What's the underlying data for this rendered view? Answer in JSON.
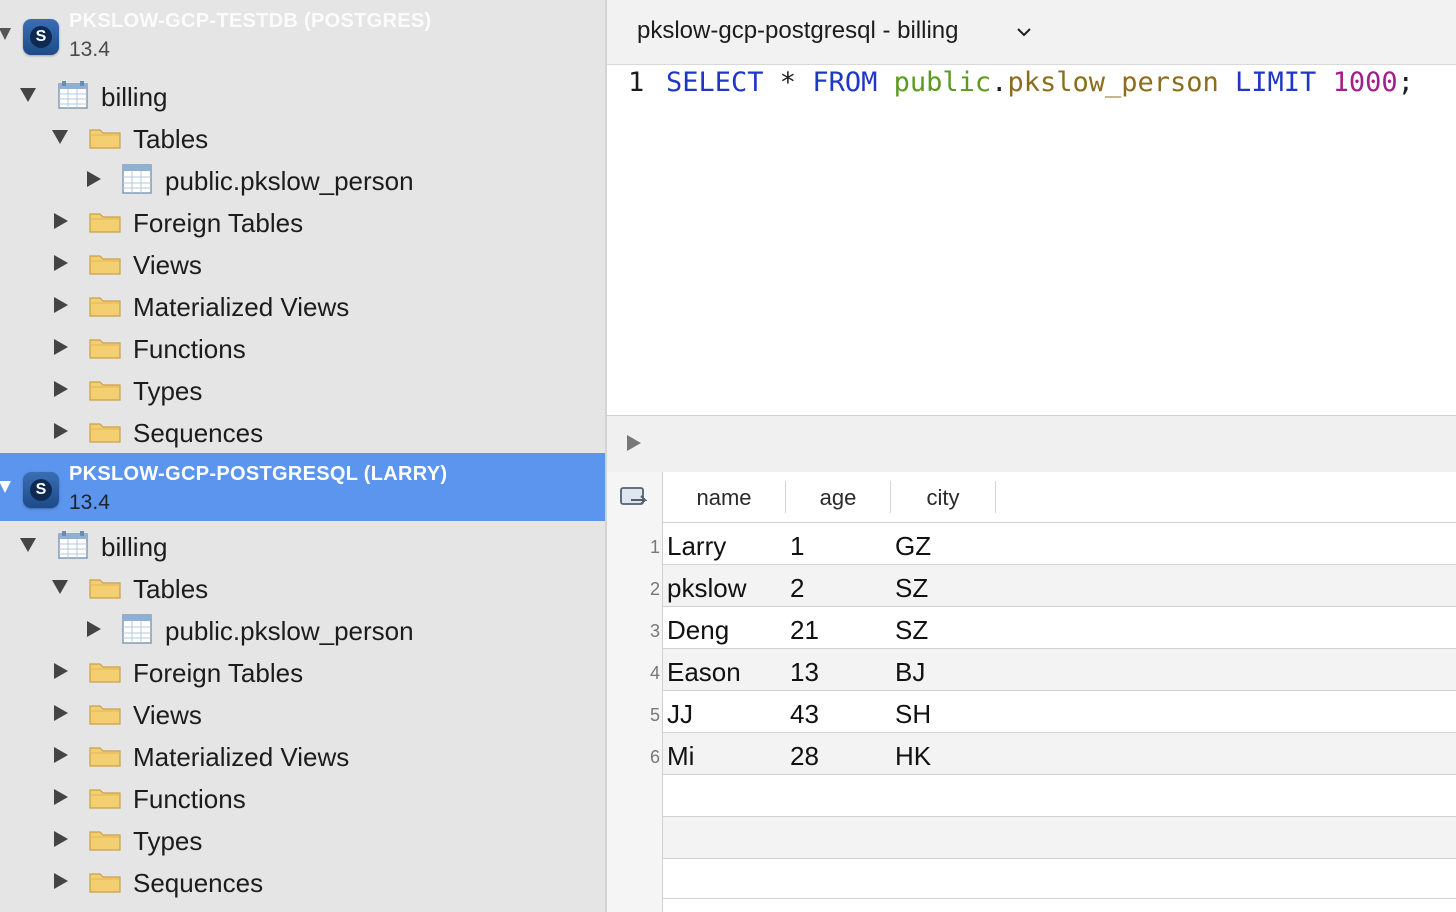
{
  "connections": [
    {
      "title": "PKSLOW-GCP-TESTDB (POSTGRES)",
      "version": "13.4",
      "database": "billing",
      "tables_folder": "Tables",
      "table": "public.pkslow_person",
      "folders": [
        "Foreign Tables",
        "Views",
        "Materialized Views",
        "Functions",
        "Types",
        "Sequences"
      ]
    },
    {
      "title": "PKSLOW-GCP-POSTGRESQL (LARRY)",
      "version": "13.4",
      "database": "billing",
      "tables_folder": "Tables",
      "table": "public.pkslow_person",
      "folders": [
        "Foreign Tables",
        "Views",
        "Materialized Views",
        "Functions",
        "Types",
        "Sequences"
      ]
    }
  ],
  "editor": {
    "tab_title": "pkslow-gcp-postgresql - billing",
    "line_number": "1",
    "tokens": {
      "select": "SELECT",
      "star": " * ",
      "from": "FROM",
      "schema": "public",
      "dot": ".",
      "table": "pkslow_person",
      "limit": "LIMIT",
      "number": "1000",
      "semicolon": ";"
    }
  },
  "results": {
    "columns": [
      "name",
      "age",
      "city"
    ],
    "rows": [
      {
        "num": "1",
        "name": "Larry",
        "age": "1",
        "city": "GZ"
      },
      {
        "num": "2",
        "name": "pkslow",
        "age": "2",
        "city": "SZ"
      },
      {
        "num": "3",
        "name": "Deng",
        "age": "21",
        "city": "SZ"
      },
      {
        "num": "4",
        "name": "Eason",
        "age": "13",
        "city": "BJ"
      },
      {
        "num": "5",
        "name": "JJ",
        "age": "43",
        "city": "SH"
      },
      {
        "num": "6",
        "name": "Mi",
        "age": "28",
        "city": "HK"
      }
    ]
  },
  "colors": {
    "selection": "#5b95ee",
    "keyword": "#1f37c6",
    "schema": "#5c9a1e",
    "table": "#8c6d1f",
    "number": "#a11f8b"
  }
}
